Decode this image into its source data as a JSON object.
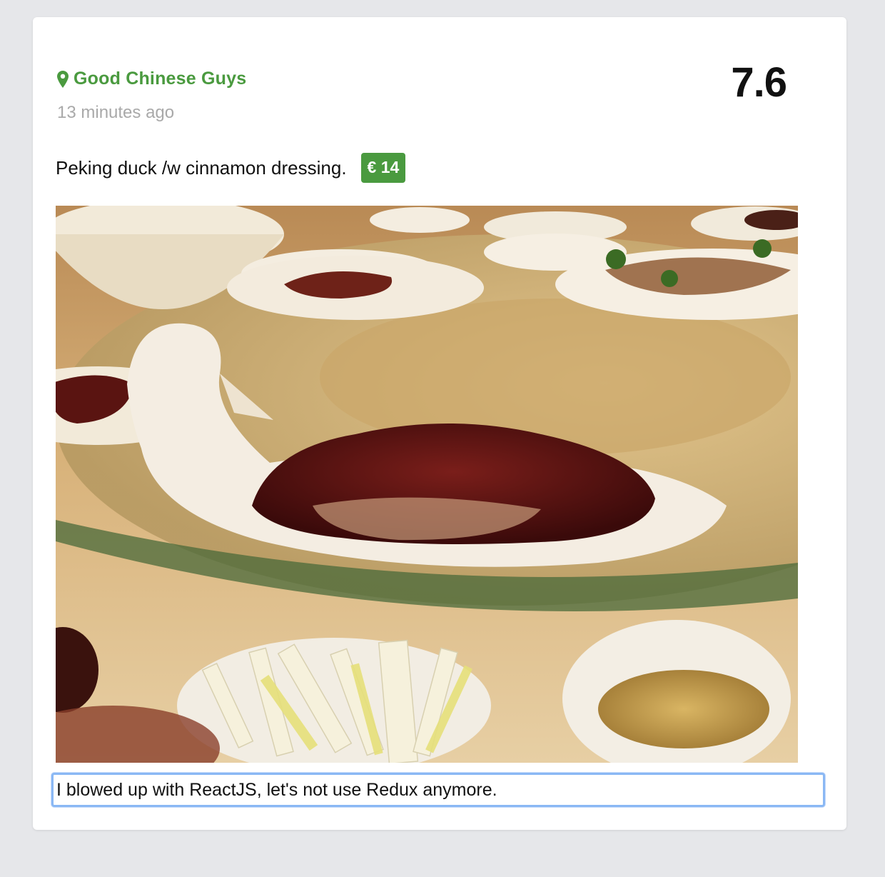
{
  "post": {
    "place_name": "Good Chinese Guys",
    "time_ago": "13 minutes ago",
    "score": "7.6",
    "dish": "Peking duck /w cinnamon dressing.",
    "price": "€ 14",
    "photo_alt": "Peking duck",
    "comment_value": "I blowed up with ReactJS, let's not use Redux anymore."
  },
  "icons": {
    "place": "map-pin-icon"
  },
  "colors": {
    "accent": "#4a9a3f",
    "muted_text": "#a9a9a9",
    "page_background": "#e6e7ea",
    "focus_border": "#8ab8f4"
  }
}
